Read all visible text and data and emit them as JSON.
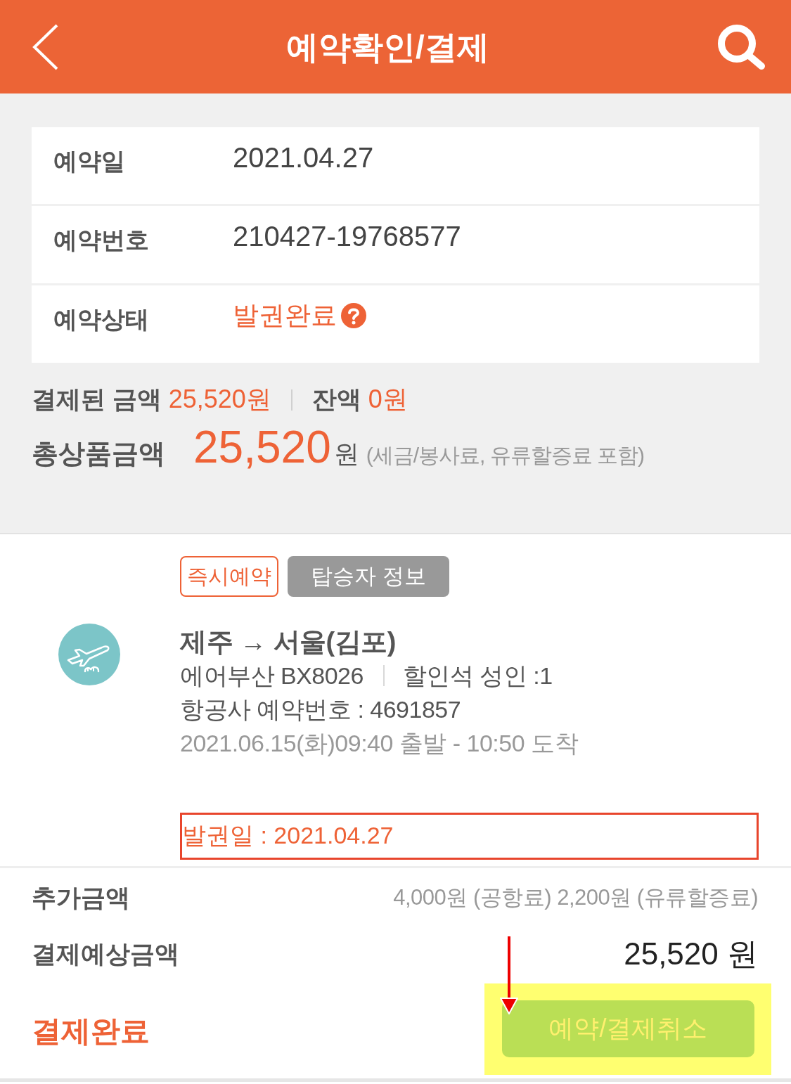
{
  "header": {
    "title": "예약확인/결제"
  },
  "reservation": [
    {
      "label": "예약일",
      "value": "2021.04.27",
      "kind": "plain"
    },
    {
      "label": "예약번호",
      "value": "210427-19768577",
      "kind": "plain"
    },
    {
      "label": "예약상태",
      "value": "발권완료",
      "kind": "status"
    }
  ],
  "payment_summary": {
    "paid_label": "결제된 금액",
    "paid_amount": "25,520원",
    "balance_label": "잔액",
    "balance_amount": "0원",
    "total_label": "총상품금액",
    "total_amount": "25,520",
    "total_unit": "원",
    "total_note": "(세금/봉사료, 유류할증료 포함)"
  },
  "flight": {
    "tags": [
      {
        "label": "즉시예약",
        "kind": "badge"
      },
      {
        "label": "탑승자 정보",
        "kind": "button"
      }
    ],
    "route": "제주 → 서울(김포)",
    "airline": "에어부산 BX8026",
    "fare": "할인석 성인 :1",
    "airline_booking": "항공사 예약번호 : 4691857",
    "schedule": "2021.06.15(화)09:40 출발 - 10:50 도착",
    "ticketed": "발권일 : 2021.04.27"
  },
  "charges": {
    "extra_label": "추가금액",
    "extra_value": "4,000원 (공항료) 2,200원 (유류할증료)",
    "expected_label": "결제예상금액",
    "expected_value": "25,520 원"
  },
  "footer": {
    "status": "결제완료",
    "cancel_button": "예약/결제취소"
  }
}
